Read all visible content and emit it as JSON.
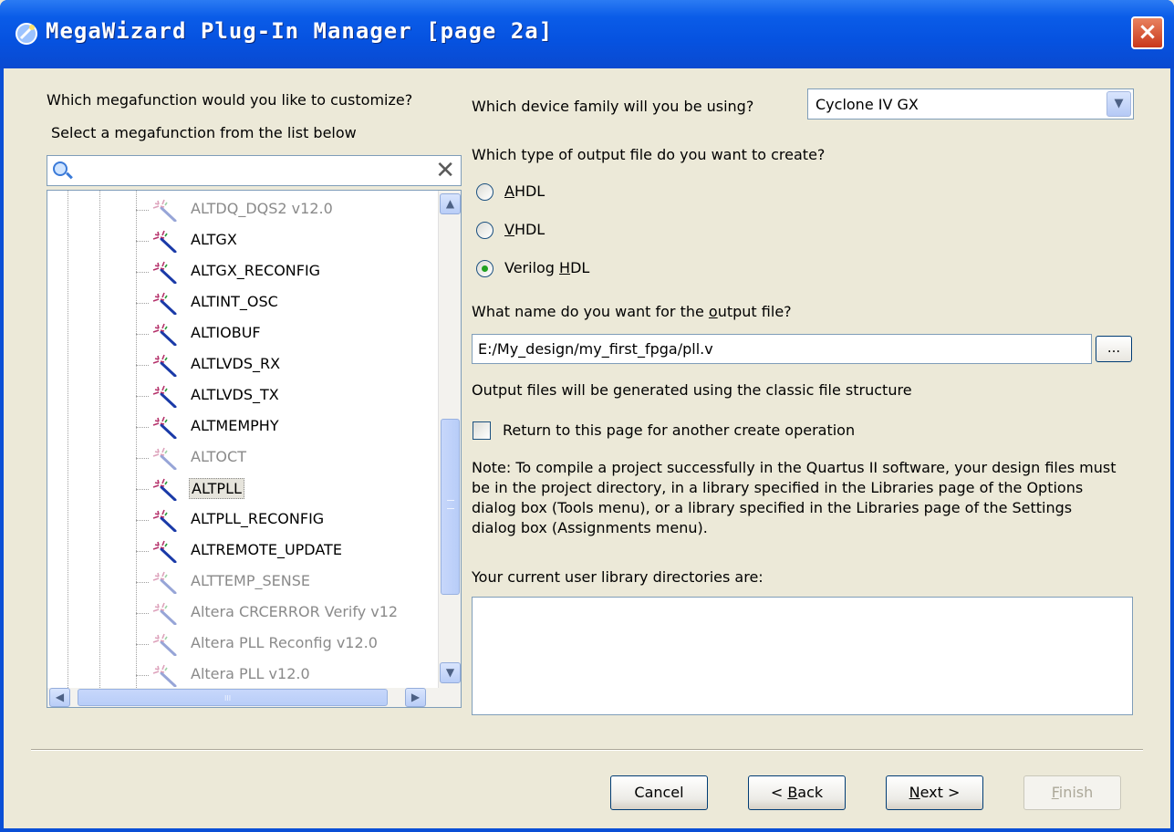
{
  "window": {
    "title": "MegaWizard Plug-In Manager [page 2a]",
    "close_glyph": "×"
  },
  "left": {
    "question": "Which megafunction would you like to customize?",
    "instruction": "Select a megafunction from the list below",
    "search": {
      "placeholder": ""
    },
    "items": [
      {
        "label": "ALTDQ_DQS2 v12.0",
        "enabled": false,
        "selected": false
      },
      {
        "label": "ALTGX",
        "enabled": true,
        "selected": false
      },
      {
        "label": "ALTGX_RECONFIG",
        "enabled": true,
        "selected": false
      },
      {
        "label": "ALTINT_OSC",
        "enabled": true,
        "selected": false
      },
      {
        "label": "ALTIOBUF",
        "enabled": true,
        "selected": false
      },
      {
        "label": "ALTLVDS_RX",
        "enabled": true,
        "selected": false
      },
      {
        "label": "ALTLVDS_TX",
        "enabled": true,
        "selected": false
      },
      {
        "label": "ALTMEMPHY",
        "enabled": true,
        "selected": false
      },
      {
        "label": "ALTOCT",
        "enabled": false,
        "selected": false
      },
      {
        "label": "ALTPLL",
        "enabled": true,
        "selected": true
      },
      {
        "label": "ALTPLL_RECONFIG",
        "enabled": true,
        "selected": false
      },
      {
        "label": "ALTREMOTE_UPDATE",
        "enabled": true,
        "selected": false
      },
      {
        "label": "ALTTEMP_SENSE",
        "enabled": false,
        "selected": false
      },
      {
        "label": "Altera CRCERROR Verify v12",
        "enabled": false,
        "selected": false
      },
      {
        "label": "Altera PLL Reconfig v12.0",
        "enabled": false,
        "selected": false
      },
      {
        "label": "Altera PLL v12.0",
        "enabled": false,
        "selected": false
      }
    ],
    "hscroll_grip": "III"
  },
  "right": {
    "device_question": "Which device family will you be using?",
    "device_value": "Cyclone IV GX",
    "output_type_question": "Which type of output file do you want to create?",
    "output_types": [
      {
        "pre": "",
        "key": "A",
        "post": "HDL",
        "checked": false
      },
      {
        "pre": "",
        "key": "V",
        "post": "HDL",
        "checked": false
      },
      {
        "pre": "Verilog ",
        "key": "H",
        "post": "DL",
        "checked": true
      }
    ],
    "name_question_pre": "What name do you want for the ",
    "name_question_key": "o",
    "name_question_post": "utput file?",
    "output_file": "E:/My_design/my_first_fpga/pll.v",
    "browse_label": "...",
    "structure_note": "Output files will be generated using the classic file structure",
    "return_checkbox_label": "Return to this page for another create operation",
    "return_checked": false,
    "compile_note": "Note: To compile a project successfully in the Quartus II software, your design files must be in the project directory, in a library specified in the Libraries page of the Options dialog box (Tools menu), or a library specified in the Libraries page of the Settings dialog box (Assignments menu).",
    "libraries_label": "Your current user library directories are:",
    "libraries": []
  },
  "footer": {
    "cancel": "Cancel",
    "back_pre": "< ",
    "back_key": "B",
    "back_post": "ack",
    "next_key": "N",
    "next_post": "ext >",
    "finish_key": "F",
    "finish_post": "inish"
  },
  "colors": {
    "titlebar": "#0a5ce8",
    "dialog_bg": "#ece9d8",
    "radio_selected": "#21a121",
    "close_button": "#c9381c"
  }
}
